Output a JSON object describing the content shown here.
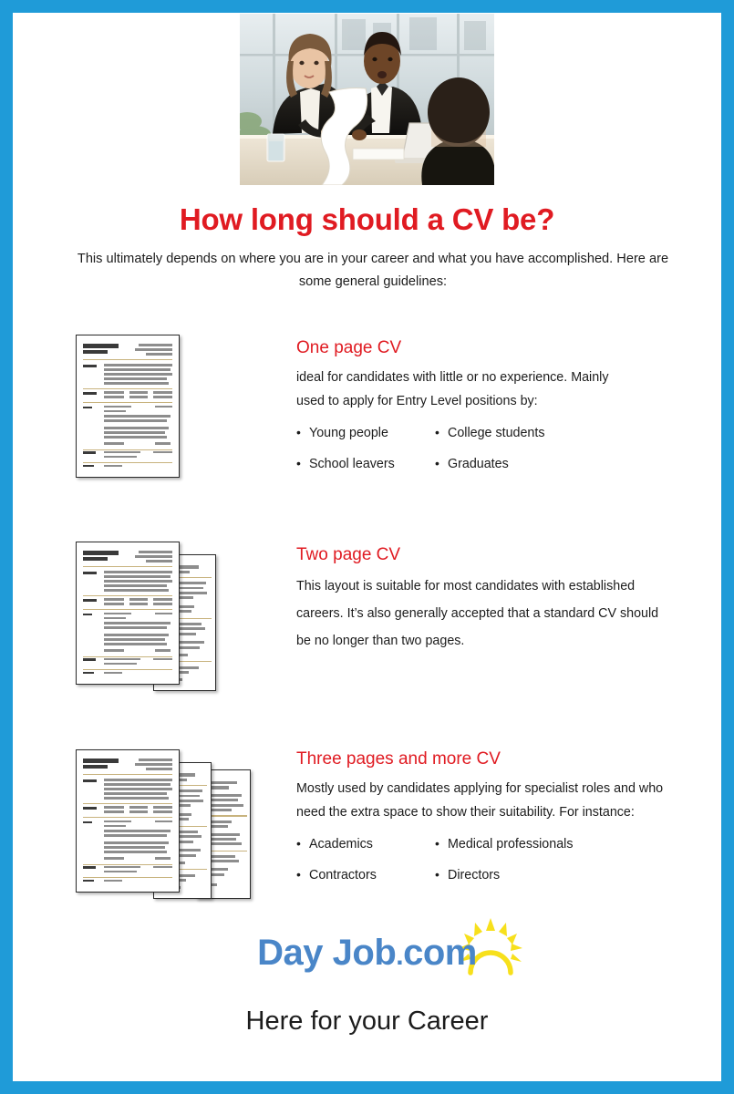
{
  "theme": {
    "border_color": "#1f9bd8",
    "heading_red": "#e01b22",
    "logo_blue": "#4a86c8",
    "sun_yellow": "#f7e01c",
    "body_text": "#1c1c1c"
  },
  "header": {
    "photo_alt": "Two interviewers at a boardroom table reviewing a very long CV while a candidate sits opposite",
    "title": "How long should a CV be?",
    "subtitle_line1": "This ultimately depends on where you are in your career and what you have accomplished.",
    "subtitle_line2": "Here are some general guidelines:"
  },
  "sections": [
    {
      "id": "one-page",
      "heading": "One page CV",
      "paragraph": "ideal for candidates with little or no experience. Mainly used to apply for Entry Level positions by:",
      "pages": 1,
      "bullets": [
        "Young people",
        "College students",
        "School leavers",
        "Graduates"
      ]
    },
    {
      "id": "two-page",
      "heading": "Two page CV",
      "paragraph": "This layout is suitable for most candidates with established careers. It’s also generally accepted that a standard CV should be no longer than two pages.",
      "pages": 2,
      "bullets": []
    },
    {
      "id": "three-page",
      "heading": "Three pages and more CV",
      "paragraph": "Mostly used by candidates applying for specialist roles and who need the extra space to show their suitability. For instance:",
      "pages": 3,
      "bullets": [
        "Academics",
        "Medical professionals",
        "Contractors",
        "Directors"
      ]
    }
  ],
  "footer": {
    "logo_day": "Day",
    "logo_job": "Job",
    "logo_dot": ".",
    "logo_com": "com",
    "sun_icon": "sun-icon",
    "tagline": "Here for your Career"
  }
}
